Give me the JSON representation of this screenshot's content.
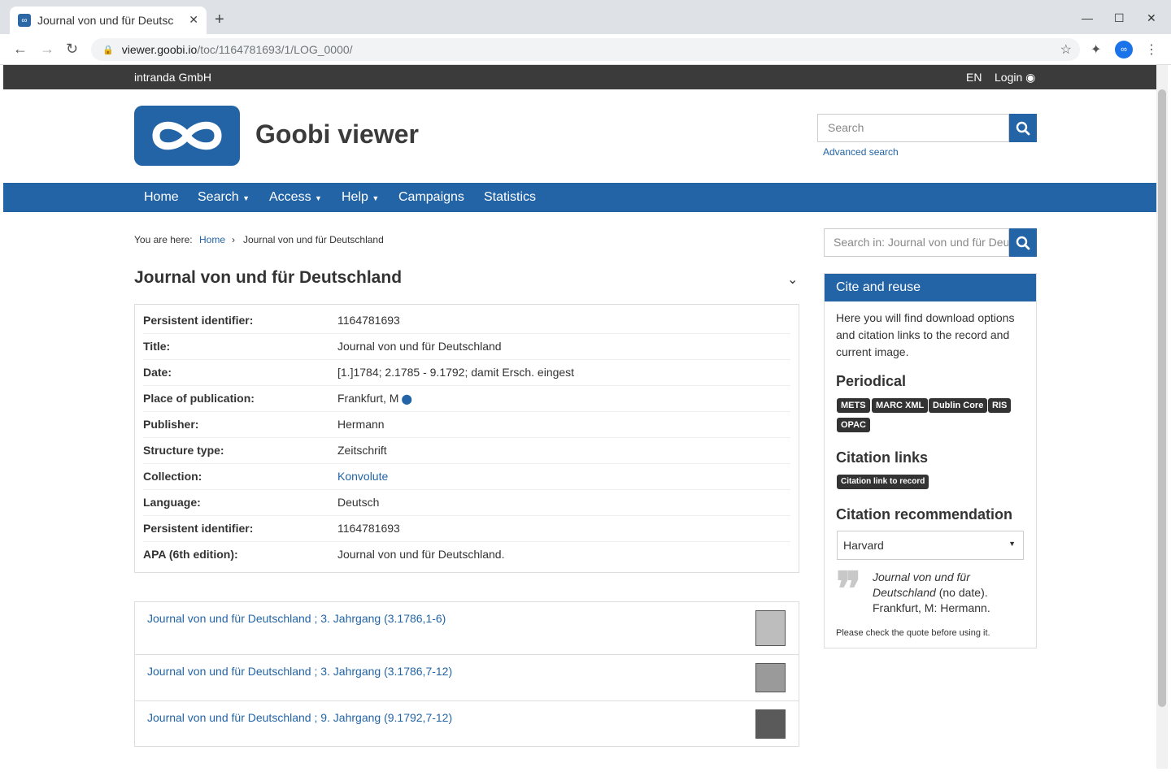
{
  "browser": {
    "tab_title": "Journal von und für Deutsc",
    "url_host": "viewer.goobi.io",
    "url_path": "/toc/1164781693/1/LOG_0000/"
  },
  "topbar": {
    "org": "intranda GmbH",
    "language": "EN",
    "login": "Login"
  },
  "header": {
    "site_title": "Goobi viewer",
    "search_placeholder": "Search",
    "advanced_search": "Advanced search"
  },
  "nav": {
    "items": [
      {
        "label": "Home"
      },
      {
        "label": "Search"
      },
      {
        "label": "Access"
      },
      {
        "label": "Help"
      },
      {
        "label": "Campaigns"
      },
      {
        "label": "Statistics"
      }
    ]
  },
  "breadcrumb": {
    "prefix": "You are here:",
    "home": "Home",
    "separator": "›",
    "current": "Journal von und für Deutschland"
  },
  "record": {
    "title": "Journal von und für Deutschland",
    "metadata": [
      {
        "label": "Persistent identifier:",
        "value": "1164781693"
      },
      {
        "label": "Title:",
        "value": "Journal von und für Deutschland"
      },
      {
        "label": "Date:",
        "value": "[1.]1784; 2.1785 - 9.1792; damit Ersch. eingest"
      },
      {
        "label": "Place of publication:",
        "value": "Frankfurt, M"
      },
      {
        "label": "Publisher:",
        "value": "Hermann"
      },
      {
        "label": "Structure type:",
        "value": "Zeitschrift"
      },
      {
        "label": "Collection:",
        "value": "Konvolute"
      },
      {
        "label": "Language:",
        "value": "Deutsch"
      },
      {
        "label": "Persistent identifier:",
        "value": "1164781693"
      },
      {
        "label": "APA (6th edition):",
        "value": "Journal von und für Deutschland."
      }
    ]
  },
  "toc": [
    {
      "label": "Journal von und für Deutschland ; 3. Jahrgang (3.1786,1-6)"
    },
    {
      "label": "Journal von und für Deutschland ; 3. Jahrgang (3.1786,7-12)"
    },
    {
      "label": "Journal von und für Deutschland ; 9. Jahrgang (9.1792,7-12)"
    }
  ],
  "sidebar": {
    "search_placeholder": "Search in: Journal von und für Deutschland",
    "cite": {
      "heading": "Cite and reuse",
      "intro": "Here you will find download options and citation links to the record and current image.",
      "periodical_heading": "Periodical",
      "badges": [
        "METS",
        "MARC XML",
        "Dublin Core",
        "RIS",
        "OPAC"
      ],
      "citation_links_heading": "Citation links",
      "citation_link": "Citation link to record",
      "recommendation_heading": "Citation recommendation",
      "style_selected": "Harvard",
      "citation_title": "Journal von und für Deutschland",
      "citation_rest": " (no date). Frankfurt, M: Hermann.",
      "note": "Please check the quote before using it."
    }
  },
  "colors": {
    "primary": "#2264a6",
    "topbar": "#3b3b3b",
    "badge": "#333333"
  }
}
